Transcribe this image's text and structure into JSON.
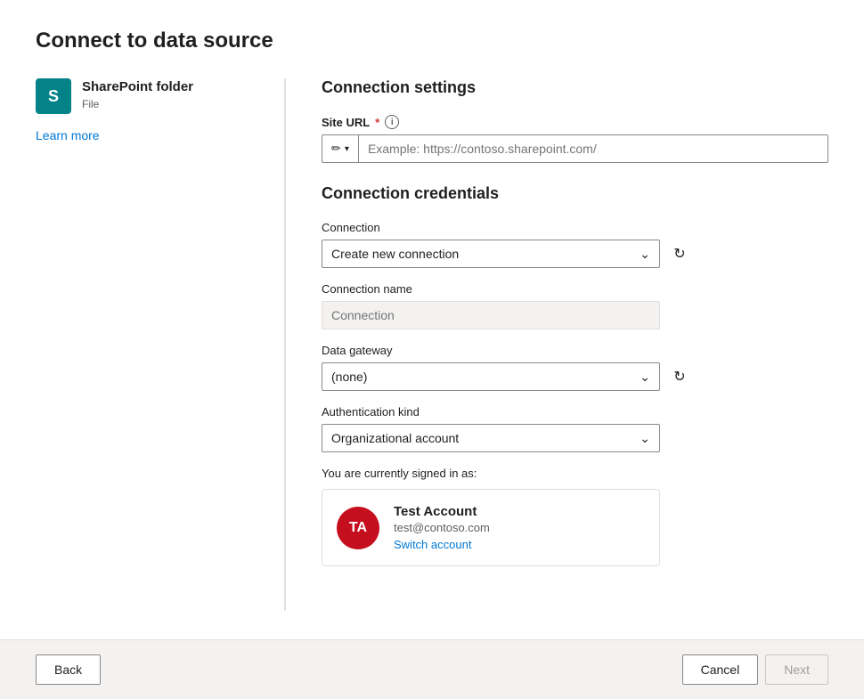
{
  "page": {
    "title": "Connect to data source"
  },
  "connector": {
    "icon_text": "S",
    "name": "SharePoint folder",
    "type": "File",
    "learn_more_label": "Learn more"
  },
  "connection_settings": {
    "section_title": "Connection settings",
    "site_url_label": "Site URL",
    "site_url_placeholder": "Example: https://contoso.sharepoint.com/",
    "info_icon_label": "ⓘ"
  },
  "connection_credentials": {
    "section_title": "Connection credentials",
    "connection_label": "Connection",
    "connection_value": "Create new connection",
    "connection_name_label": "Connection name",
    "connection_name_placeholder": "Connection",
    "data_gateway_label": "Data gateway",
    "data_gateway_value": "(none)",
    "auth_kind_label": "Authentication kind",
    "auth_kind_value": "Organizational account",
    "signed_in_label": "You are currently signed in as:",
    "account": {
      "initials": "TA",
      "name": "Test Account",
      "email": "test@contoso.com",
      "switch_label": "Switch account"
    }
  },
  "footer": {
    "back_label": "Back",
    "cancel_label": "Cancel",
    "next_label": "Next"
  }
}
